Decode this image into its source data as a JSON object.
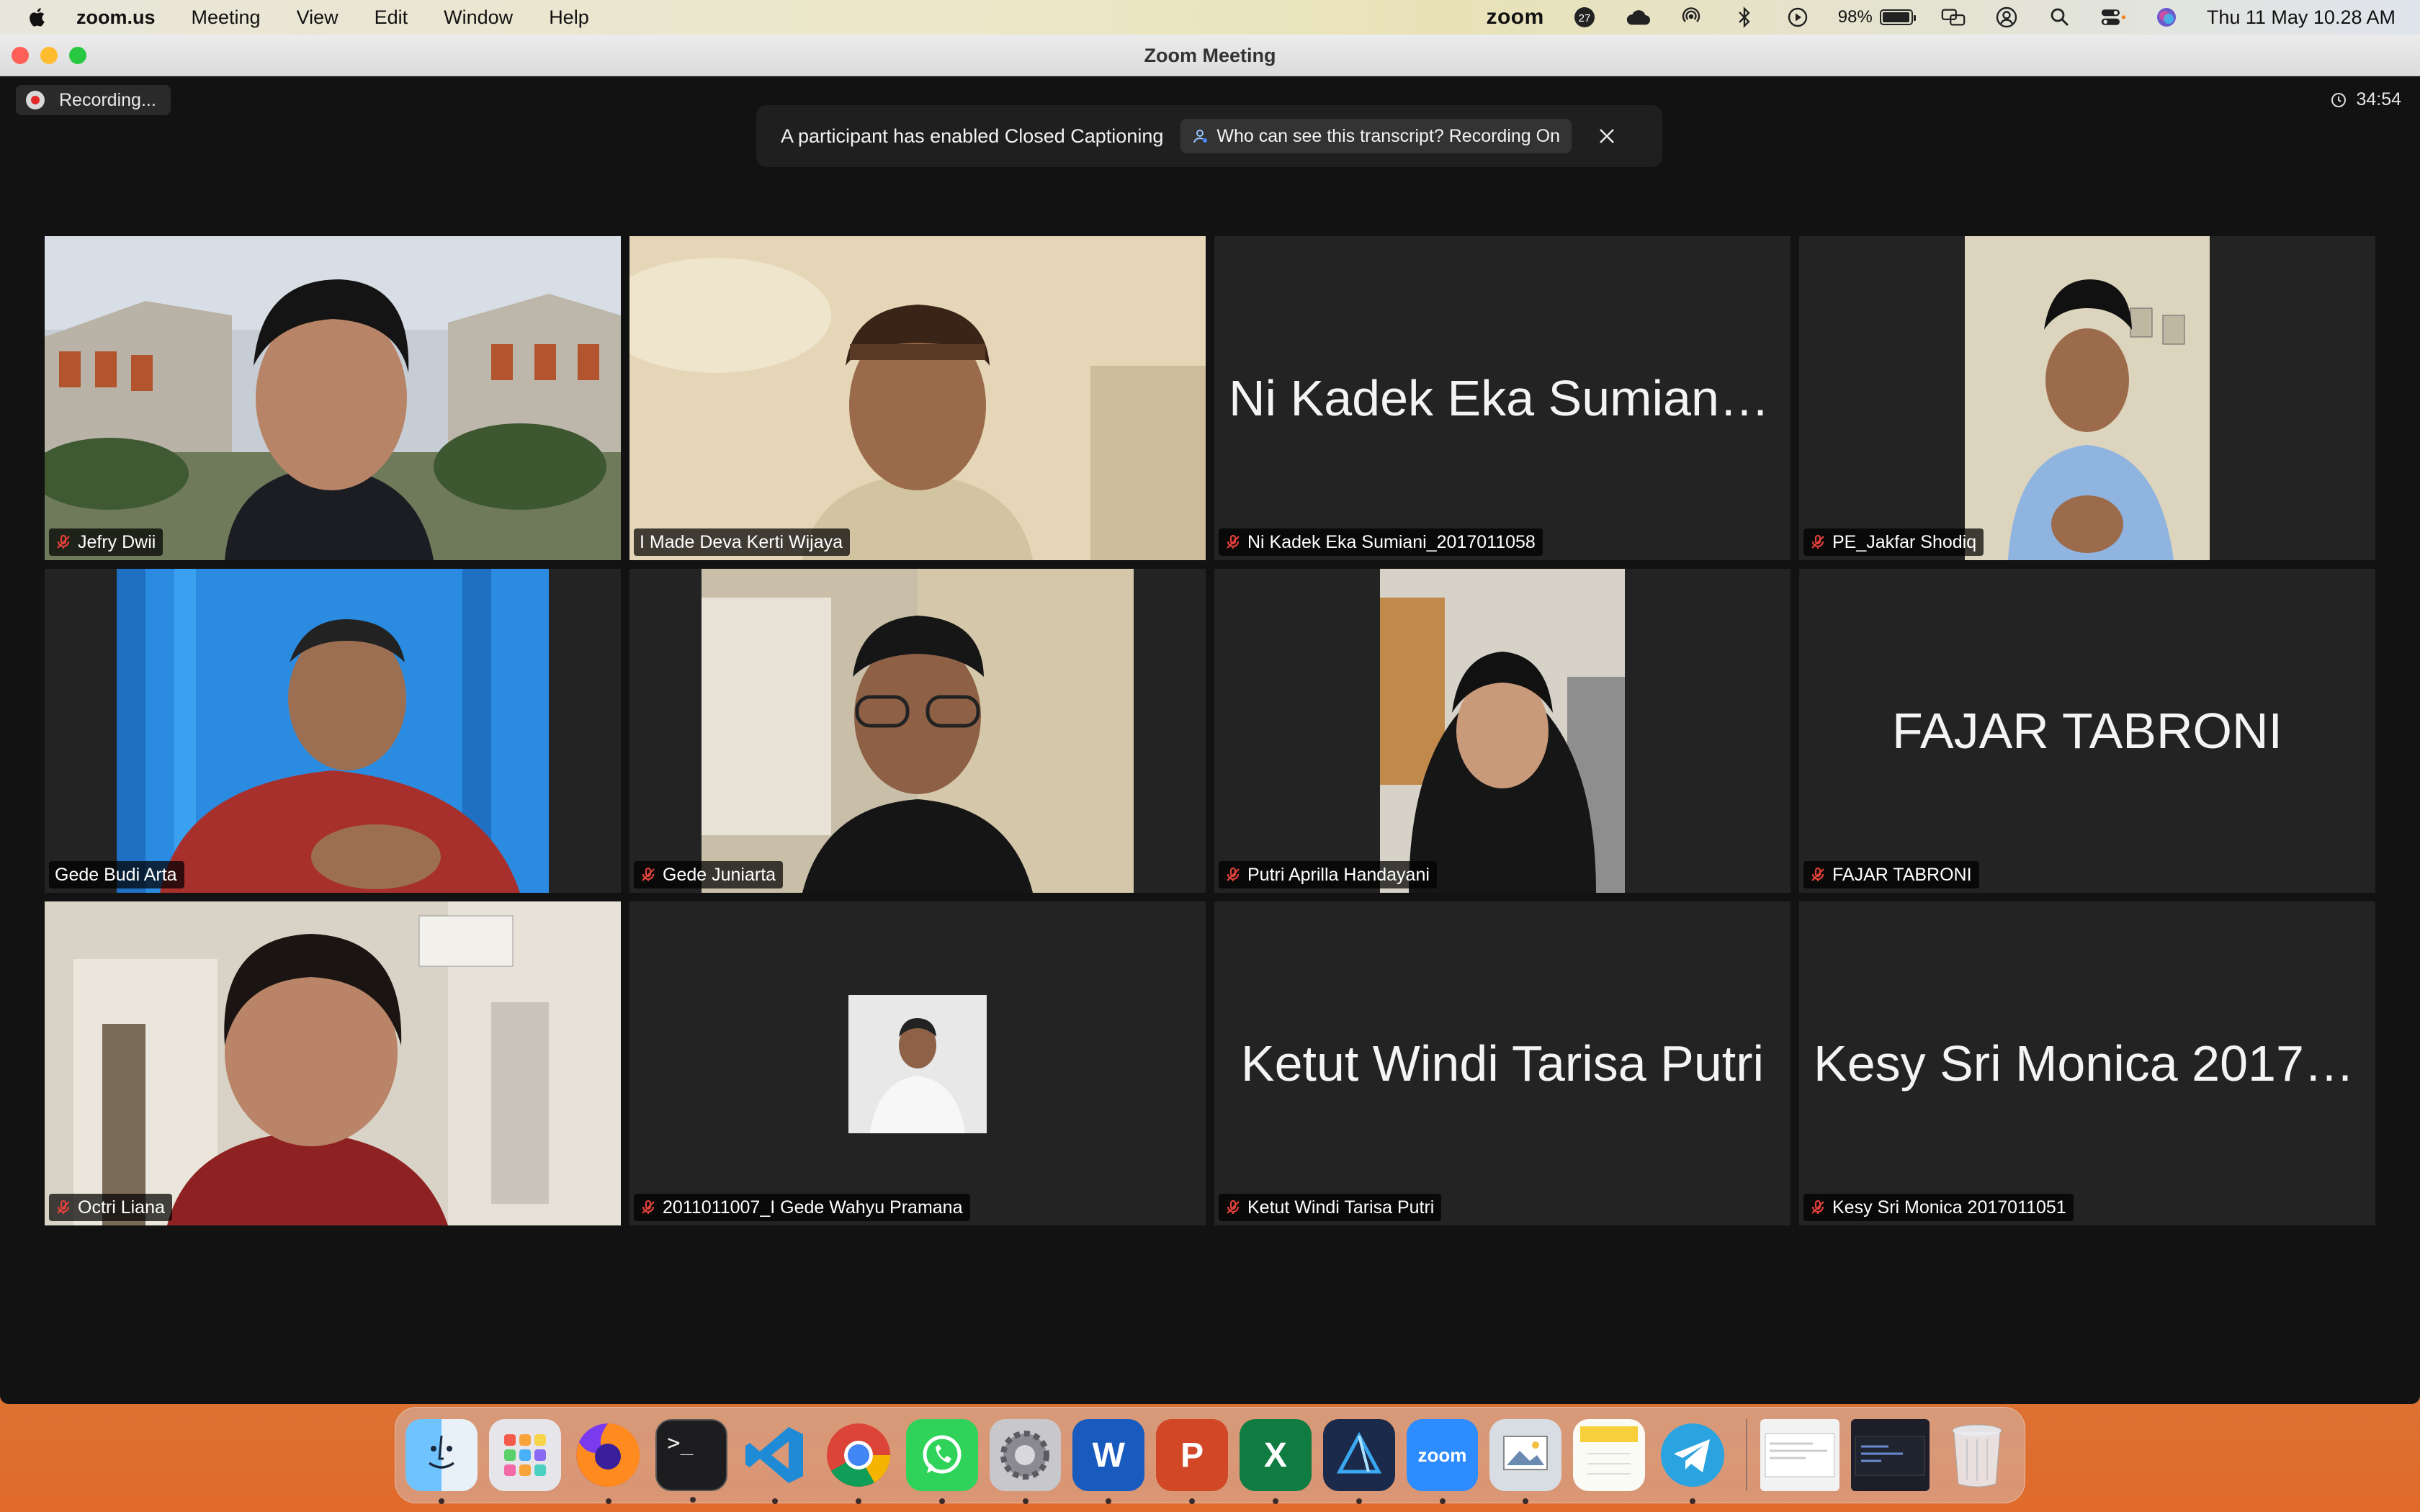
{
  "menubar": {
    "app_name": "zoom.us",
    "menus": [
      "Meeting",
      "View",
      "Edit",
      "Window",
      "Help"
    ],
    "zoom_logo": "zoom",
    "notification_count": "27",
    "battery_percent": "98%",
    "battery_level": 0.98,
    "datetime": "Thu 11 May  10.28 AM"
  },
  "window": {
    "title": "Zoom Meeting",
    "recording_label": "Recording...",
    "timer": "34:54"
  },
  "caption_banner": {
    "text": "A participant has enabled Closed Captioning",
    "pill": "Who can see this transcript? Recording On"
  },
  "participants": [
    {
      "name": "Jefry Dwii",
      "muted": true,
      "display": "video"
    },
    {
      "name": "I Made Deva Kerti Wijaya",
      "muted": false,
      "display": "video",
      "active_speaker": true
    },
    {
      "name": "Ni Kadek Eka Sumiani_2017011058",
      "muted": true,
      "display": "name",
      "big_name": "Ni Kadek Eka Sumiani_..."
    },
    {
      "name": "PE_Jakfar Shodiq",
      "muted": true,
      "display": "video"
    },
    {
      "name": "Gede Budi Arta",
      "muted": false,
      "display": "video"
    },
    {
      "name": "Gede Juniarta",
      "muted": true,
      "display": "video"
    },
    {
      "name": "Putri Aprilla Handayani",
      "muted": true,
      "display": "video"
    },
    {
      "name": "FAJAR TABRONI",
      "muted": true,
      "display": "name",
      "big_name": "FAJAR TABRONI"
    },
    {
      "name": "Octri Liana",
      "muted": true,
      "display": "video"
    },
    {
      "name": "2011011007_I Gede Wahyu Pramana",
      "muted": true,
      "display": "photo"
    },
    {
      "name": "Ketut Windi Tarisa Putri",
      "muted": true,
      "display": "name",
      "big_name": "Ketut Windi Tarisa Putri"
    },
    {
      "name": "Kesy Sri Monica 2017011051",
      "muted": true,
      "display": "name",
      "big_name": "Kesy Sri Monica 20170..."
    }
  ],
  "dock": {
    "apps": [
      "Finder",
      "Launchpad",
      "Firefox",
      "Terminal",
      "Visual Studio Code",
      "Google Chrome",
      "WhatsApp",
      "System Settings",
      "Microsoft Word",
      "Microsoft PowerPoint",
      "Microsoft Excel",
      "Affinity Designer",
      "Zoom",
      "Preview",
      "Notes",
      "Telegram"
    ],
    "zoom_label": "zoom",
    "terminal_prompt": ">_",
    "word_letter": "W",
    "powerpoint_letter": "P",
    "excel_letter": "X"
  },
  "colors": {
    "active_speaker": "#2fd04a",
    "muted_icon": "#e0413a",
    "tile_bg": "#232323",
    "window_bg": "#121212"
  }
}
